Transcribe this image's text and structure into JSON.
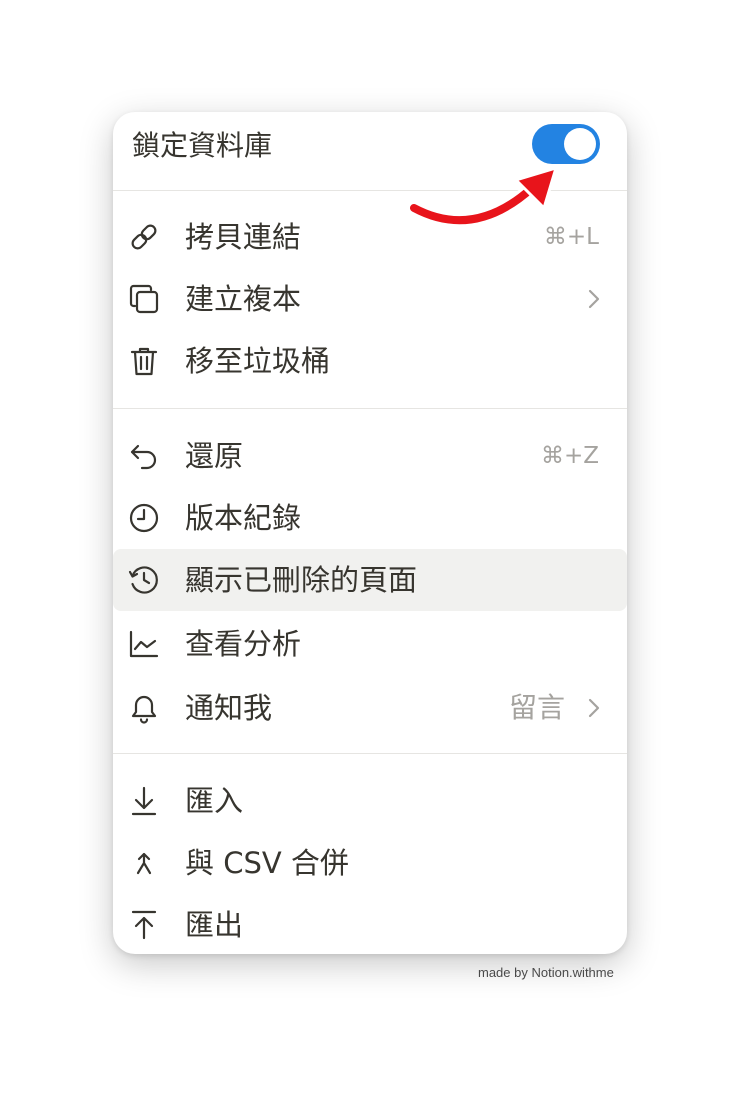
{
  "lock_database": {
    "label": "鎖定資料庫",
    "toggle_on": true,
    "toggle_color": "#2383e2"
  },
  "sections": [
    {
      "items": [
        {
          "id": "copy-link",
          "label": "拷貝連結",
          "shortcut": "⌘+L",
          "icon": "link-icon"
        },
        {
          "id": "duplicate",
          "label": "建立複本",
          "submenu": true,
          "icon": "duplicate-icon"
        },
        {
          "id": "move-to-trash",
          "label": "移至垃圾桶",
          "icon": "trash-icon"
        }
      ]
    },
    {
      "items": [
        {
          "id": "undo",
          "label": "還原",
          "shortcut": "⌘+Z",
          "icon": "undo-icon"
        },
        {
          "id": "version-history",
          "label": "版本紀錄",
          "icon": "clock-icon"
        },
        {
          "id": "show-deleted-pages",
          "label": "顯示已刪除的頁面",
          "icon": "history-icon",
          "highlighted": true
        },
        {
          "id": "view-analytics",
          "label": "查看分析",
          "icon": "analytics-icon"
        },
        {
          "id": "notify-me",
          "label": "通知我",
          "value": "留言",
          "submenu": true,
          "icon": "bell-icon"
        }
      ]
    },
    {
      "items": [
        {
          "id": "import",
          "label": "匯入",
          "icon": "import-icon"
        },
        {
          "id": "merge-csv",
          "label": "與 CSV 合併",
          "icon": "merge-icon"
        },
        {
          "id": "export",
          "label": "匯出",
          "icon": "export-icon"
        }
      ]
    }
  ],
  "annotation": {
    "arrow_color": "#e8141b"
  },
  "watermark": "made by Notion.withme"
}
